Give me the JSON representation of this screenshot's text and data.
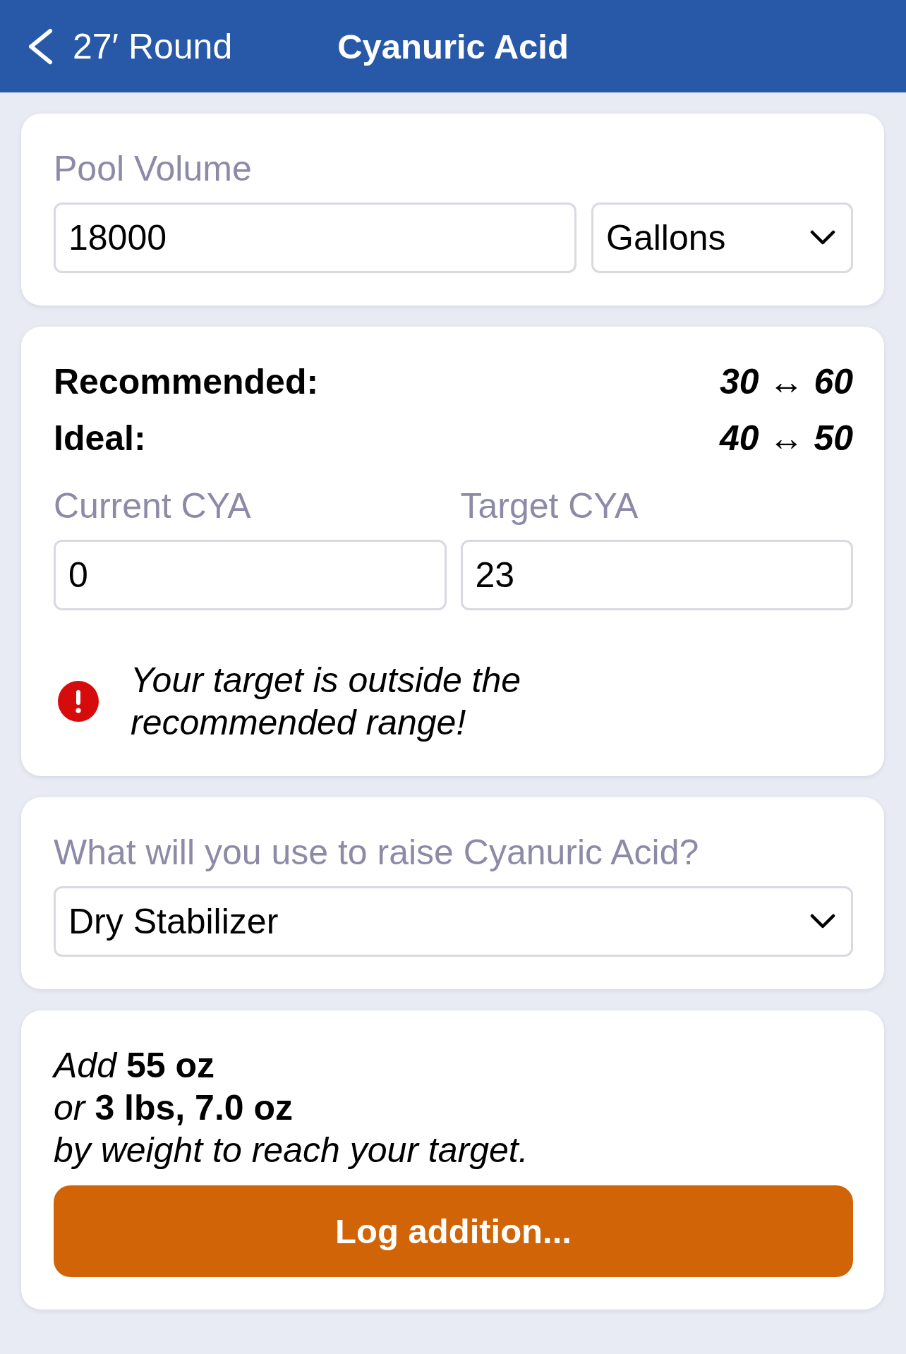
{
  "nav_bar": {
    "back_label": "27′ Round",
    "title": "Cyanuric Acid"
  },
  "pool_volume": {
    "label": "Pool Volume",
    "value": "18000",
    "unit": "Gallons"
  },
  "ranges": [
    {
      "label": "Recommended:",
      "value": "30 ↔ 60"
    },
    {
      "label": "Ideal:",
      "value": "40 ↔ 50"
    }
  ],
  "cya_fields": [
    {
      "label": "Current CYA",
      "value": "0"
    },
    {
      "label": "Target CYA",
      "value": "23"
    }
  ],
  "warning": {
    "text": "Your target is outside the recommended range!"
  },
  "source": {
    "label": "What will you use to raise Cyanuric Acid?",
    "value": "Dry Stabilizer"
  },
  "result": {
    "lines": [
      "*Add* **55 oz**",
      "*or* **3 lbs, 7.0 oz**",
      "*by weight to reach your target.*"
    ],
    "button": "Log addition..."
  }
}
